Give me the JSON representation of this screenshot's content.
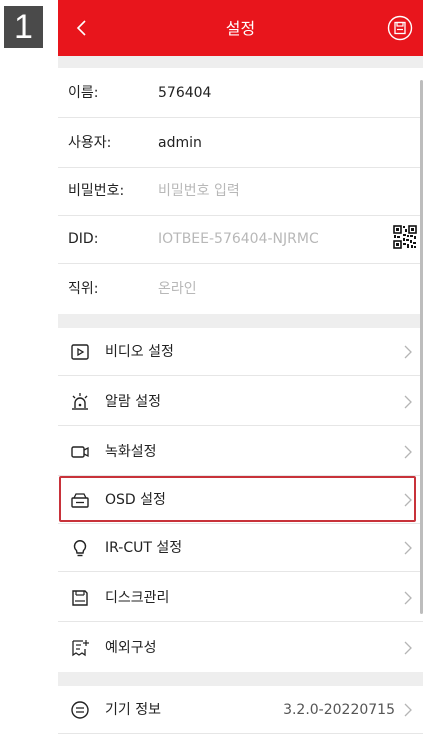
{
  "step_number": "1",
  "header": {
    "title": "설정",
    "back_icon": "chevron-left-icon",
    "save_icon": "save-circle-icon",
    "background": "#e8151c"
  },
  "info": {
    "name_label": "이름:",
    "name_value": "576404",
    "user_label": "사용자:",
    "user_value": "admin",
    "password_label": "비밀번호:",
    "password_placeholder": "비밀번호 입력",
    "did_label": "DID:",
    "did_value": "IOTBEE-576404-NJRMC",
    "position_label": "직위:",
    "position_value": "온라인"
  },
  "menu": {
    "video": "비디오 설정",
    "alarm": "알람 설정",
    "record": "녹화설정",
    "osd": "OSD 설정",
    "ircut": "IR-CUT 설정",
    "disk": "디스크관리",
    "exception": "예외구성",
    "device_info": "기기 정보",
    "device_version": "3.2.0-20220715"
  },
  "highlight_color": "#c8323a"
}
